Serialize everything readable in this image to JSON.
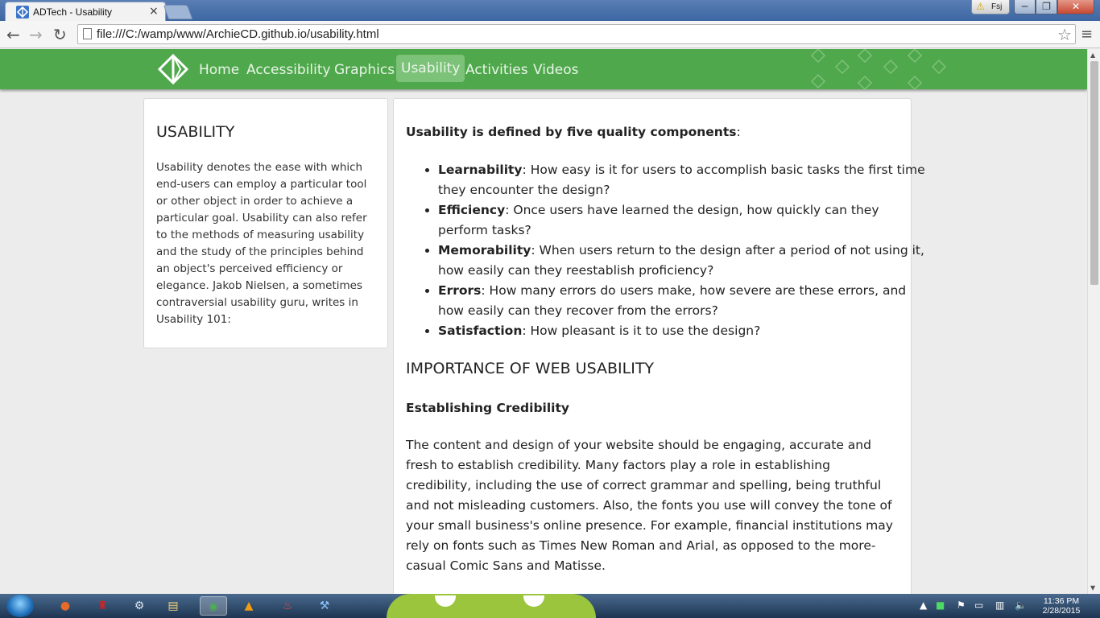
{
  "browser": {
    "tab_title": "ADTech - Usability",
    "tab_close": "×",
    "user_name": "Fsj",
    "url": "file:///C:/wamp/www/ArchieCD.github.io/usability.html",
    "back": "←",
    "forward": "→",
    "reload": "↻",
    "star": "☆",
    "menu": "≡",
    "window_min": "─",
    "window_max": "❐",
    "window_close": "✕"
  },
  "nav": {
    "links": [
      "Home",
      "Accessibility",
      "Graphics",
      "Usability",
      "Activities",
      "Videos"
    ],
    "active": "Usability",
    "color": "#4fa84b"
  },
  "sidebar": {
    "title": "USABILITY",
    "text": "Usability denotes the ease with which end-users can employ a particular tool or other object in order to achieve a particular goal. Usability can also refer to the methods of measuring usability and the study of the principles behind an object's perceived efficiency or elegance. Jakob Nielsen, a sometimes contraversial usability guru, writes in Usability 101:"
  },
  "main": {
    "intro_bold": "Usability is defined by five quality components",
    "intro_tail": ":",
    "components": [
      {
        "term": "Learnability",
        "desc": ": How easy is it for users to accomplish basic tasks the first time they encounter the design?"
      },
      {
        "term": "Efficiency",
        "desc": ": Once users have learned the design, how quickly can they perform tasks?"
      },
      {
        "term": "Memorability",
        "desc": ": When users return to the design after a period of not using it, how easily can they reestablish proficiency?"
      },
      {
        "term": "Errors",
        "desc": ": How many errors do users make, how severe are these errors, and how easily can they recover from the errors?"
      },
      {
        "term": "Satisfaction",
        "desc": ": How pleasant is it to use the design?"
      }
    ],
    "importance_heading": "IMPORTANCE OF WEB USABILITY",
    "credibility_heading": "Establishing Credibility",
    "credibility_text": "The content and design of your website should be engaging, accurate and fresh to establish credibility. Many factors play a role in establishing credibility, including the use of correct grammar and spelling, being truthful and not misleading customers. Also, the fonts you use will convey the tone of your small business's online presence. For example, financial institutions may rely on fonts such as Times New Roman and Arial, as opposed to the more-casual Comic Sans and Matisse."
  },
  "taskbar": {
    "time": "11:36 PM",
    "date": "2/28/2015",
    "icons": [
      "firefox-icon",
      "antivirus-icon",
      "steam-icon",
      "explorer-icon",
      "chrome-icon",
      "vlc-icon",
      "xampp-icon",
      "tool-icon"
    ]
  }
}
